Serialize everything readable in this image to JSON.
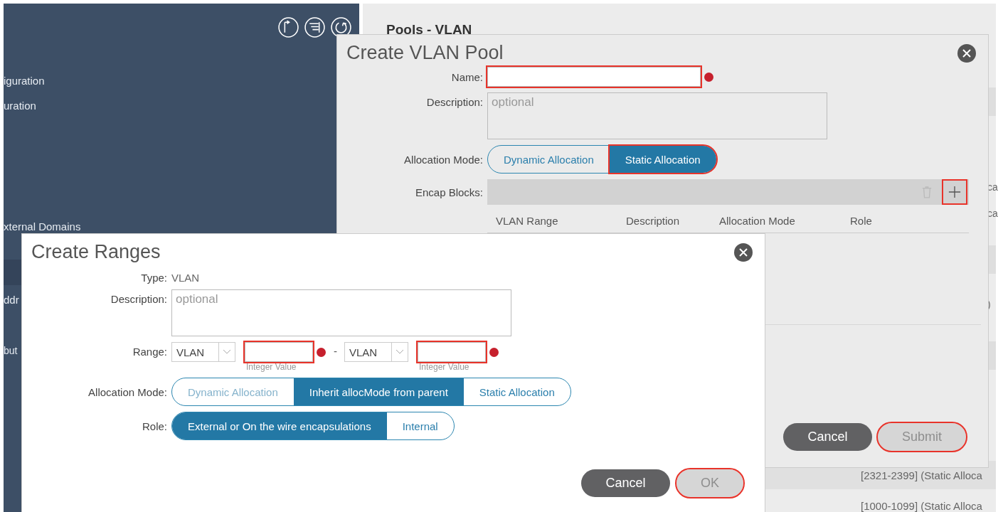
{
  "sidebar": {
    "items": [
      {
        "label": "iguration"
      },
      {
        "label": "uration"
      },
      {
        "label": "xternal Domains"
      },
      {
        "label": "ddr"
      },
      {
        "label": "but"
      }
    ]
  },
  "page": {
    "title": "Pools - VLAN",
    "fragments": [
      "ca",
      "ca",
      ")"
    ],
    "rows": [
      "[2321-2399] (Static Alloca",
      "[1000-1099] (Static Alloca"
    ]
  },
  "vlan_pool_dialog": {
    "title": "Create VLAN Pool",
    "name": {
      "label": "Name:",
      "required": true,
      "highlighted": true
    },
    "description": {
      "label": "Description:",
      "placeholder": "optional"
    },
    "allocation_mode": {
      "label": "Allocation Mode:",
      "options": [
        {
          "label": "Dynamic Allocation",
          "selected": false,
          "highlighted": false
        },
        {
          "label": "Static Allocation",
          "selected": true,
          "highlighted": true
        }
      ]
    },
    "encap_blocks": {
      "label": "Encap Blocks:",
      "add_highlighted": true,
      "columns": [
        "VLAN Range",
        "Description",
        "Allocation Mode",
        "Role"
      ]
    },
    "buttons": [
      {
        "label": "Cancel",
        "kind": "secondary",
        "disabled": false,
        "highlighted": false
      },
      {
        "label": "Submit",
        "kind": "primary",
        "disabled": true,
        "highlighted": true
      }
    ]
  },
  "ranges_dialog": {
    "title": "Create Ranges",
    "type": {
      "label": "Type:",
      "value": "VLAN"
    },
    "description": {
      "label": "Description:",
      "placeholder": "optional"
    },
    "range": {
      "label": "Range:",
      "separator": "-",
      "ends": [
        {
          "select": "VLAN",
          "hint": "Integer Value",
          "required": true,
          "highlighted": true
        },
        {
          "select": "VLAN",
          "hint": "Integer Value",
          "required": true,
          "highlighted": true
        }
      ]
    },
    "allocation_mode": {
      "label": "Allocation Mode:",
      "options": [
        {
          "label": "Dynamic Allocation",
          "selected": false,
          "disabled": true
        },
        {
          "label": "Inherit allocMode from parent",
          "selected": true,
          "disabled": false
        },
        {
          "label": "Static Allocation",
          "selected": false,
          "disabled": false
        }
      ]
    },
    "role": {
      "label": "Role:",
      "options": [
        {
          "label": "External or On the wire encapsulations",
          "selected": true
        },
        {
          "label": "Internal",
          "selected": false
        }
      ]
    },
    "buttons": [
      {
        "label": "Cancel",
        "kind": "secondary",
        "disabled": false,
        "highlighted": false
      },
      {
        "label": "OK",
        "kind": "primary",
        "disabled": true,
        "highlighted": true
      }
    ]
  }
}
